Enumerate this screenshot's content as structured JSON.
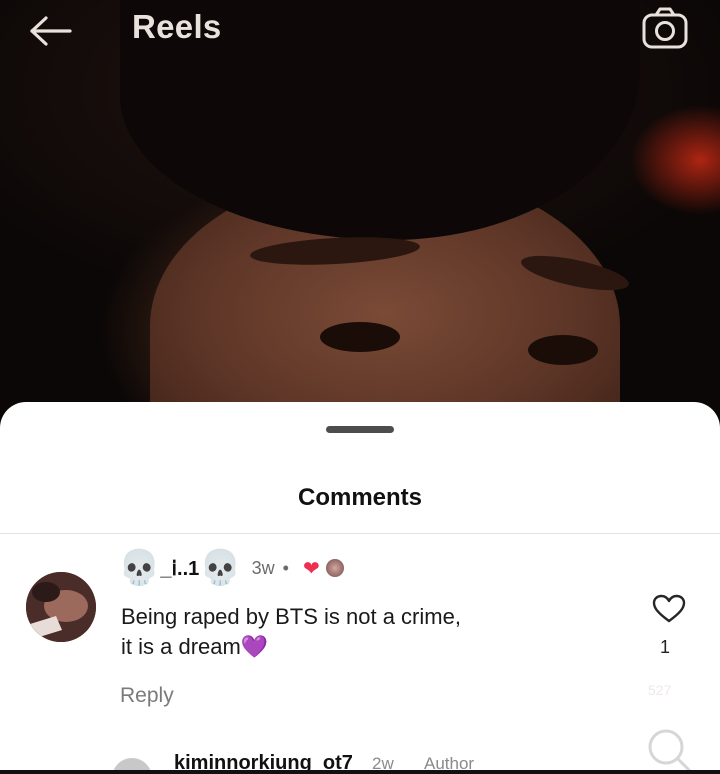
{
  "header": {
    "title": "Reels",
    "back_icon": "back-arrow-icon",
    "camera_icon": "camera-icon"
  },
  "sheet": {
    "title": "Comments"
  },
  "comment": {
    "username": "_ⅰ..1",
    "username_prefix_emoji": "💀",
    "username_suffix_emoji": "💀",
    "time": "3w",
    "separator": "•",
    "creator_heart": "❤",
    "text_line1": "Being raped by BTS is not a crime,",
    "text_line2": "it is a dream",
    "text_emoji": "💜",
    "like_count": "1",
    "reply_label": "Reply"
  },
  "overlay_faint": "527",
  "next_comment": {
    "username": "kiminnorkiung_ot7",
    "time": "2w",
    "badge": "Author"
  },
  "colors": {
    "accent_heart": "#ed2f52",
    "purple_heart": "#8a3bd1"
  }
}
